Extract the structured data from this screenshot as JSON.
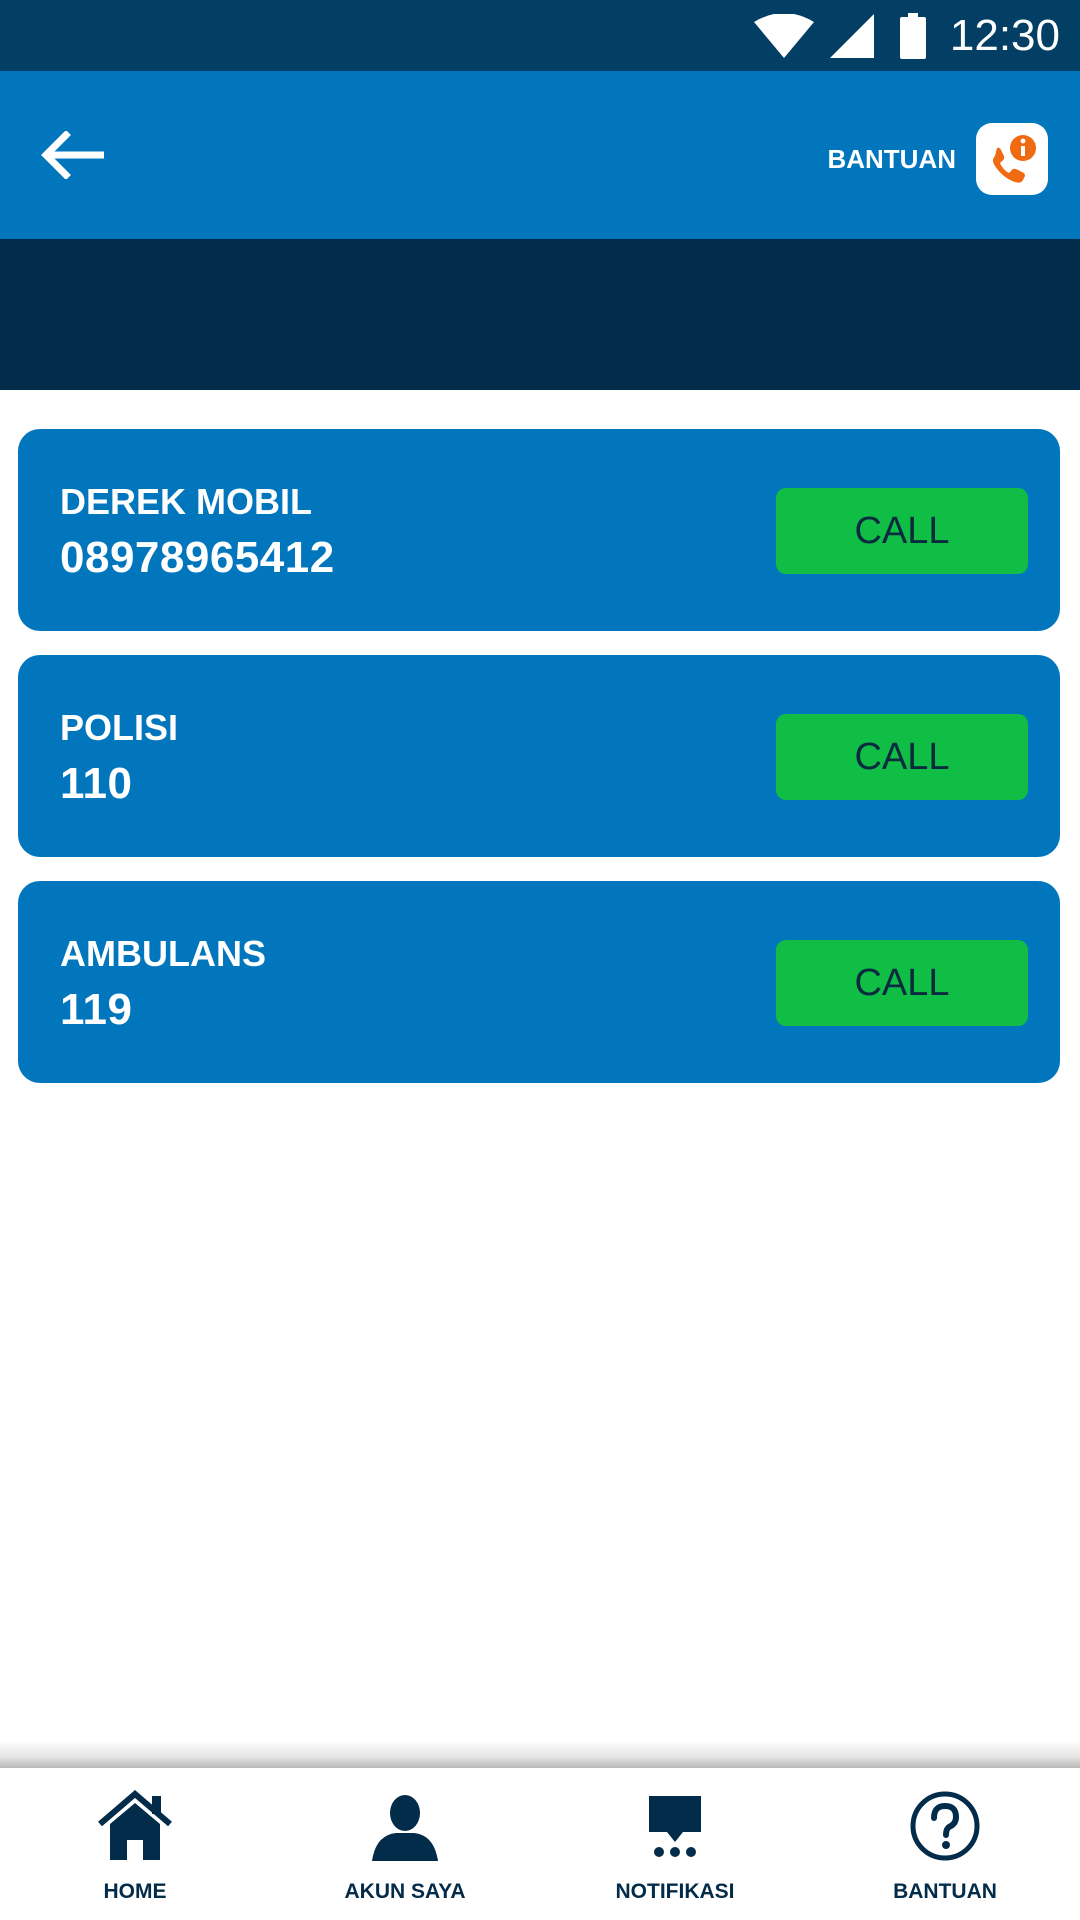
{
  "status_bar": {
    "time": "12:30",
    "icons": [
      "wifi-icon",
      "signal-icon",
      "battery-icon"
    ]
  },
  "app_bar": {
    "back_icon": "arrow-left-icon",
    "help_label": "BANTUAN",
    "help_icon": "phone-info-icon"
  },
  "contacts": [
    {
      "name": "DEREK MOBIL",
      "number": "08978965412",
      "button_label": "CALL"
    },
    {
      "name": "POLISI",
      "number": "110",
      "button_label": "CALL"
    },
    {
      "name": "AMBULANS",
      "number": "119",
      "button_label": "CALL"
    }
  ],
  "bottom_nav": {
    "items": [
      {
        "label": "HOME",
        "icon": "home-icon"
      },
      {
        "label": "AKUN SAYA",
        "icon": "user-icon"
      },
      {
        "label": "NOTIFIKASI",
        "icon": "chat-icon"
      },
      {
        "label": "BANTUAN",
        "icon": "question-icon"
      }
    ]
  },
  "colors": {
    "status_bar": "#033e64",
    "app_bar": "#0176bd",
    "banner": "#032b4a",
    "card": "#0176bd",
    "call_button": "#11be45",
    "help_accent": "#f06a12",
    "nav_text": "#032b4a"
  }
}
